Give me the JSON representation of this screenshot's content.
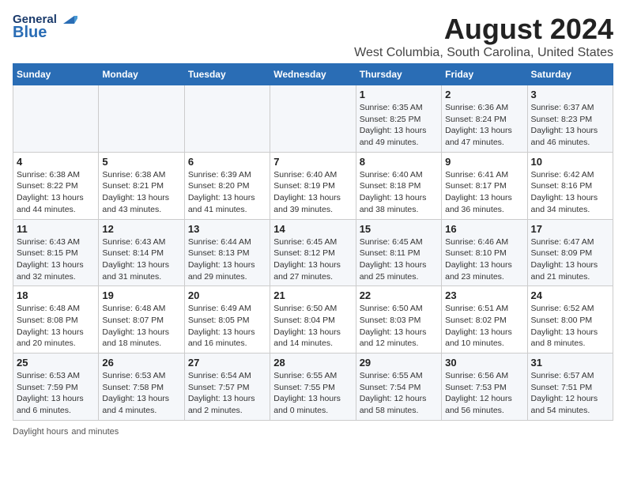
{
  "logo": {
    "general": "General",
    "blue": "Blue"
  },
  "title": "August 2024",
  "subtitle": "West Columbia, South Carolina, United States",
  "days_of_week": [
    "Sunday",
    "Monday",
    "Tuesday",
    "Wednesday",
    "Thursday",
    "Friday",
    "Saturday"
  ],
  "weeks": [
    [
      {
        "day": "",
        "info": ""
      },
      {
        "day": "",
        "info": ""
      },
      {
        "day": "",
        "info": ""
      },
      {
        "day": "",
        "info": ""
      },
      {
        "day": "1",
        "info": "Sunrise: 6:35 AM\nSunset: 8:25 PM\nDaylight: 13 hours\nand 49 minutes."
      },
      {
        "day": "2",
        "info": "Sunrise: 6:36 AM\nSunset: 8:24 PM\nDaylight: 13 hours\nand 47 minutes."
      },
      {
        "day": "3",
        "info": "Sunrise: 6:37 AM\nSunset: 8:23 PM\nDaylight: 13 hours\nand 46 minutes."
      }
    ],
    [
      {
        "day": "4",
        "info": "Sunrise: 6:38 AM\nSunset: 8:22 PM\nDaylight: 13 hours\nand 44 minutes."
      },
      {
        "day": "5",
        "info": "Sunrise: 6:38 AM\nSunset: 8:21 PM\nDaylight: 13 hours\nand 43 minutes."
      },
      {
        "day": "6",
        "info": "Sunrise: 6:39 AM\nSunset: 8:20 PM\nDaylight: 13 hours\nand 41 minutes."
      },
      {
        "day": "7",
        "info": "Sunrise: 6:40 AM\nSunset: 8:19 PM\nDaylight: 13 hours\nand 39 minutes."
      },
      {
        "day": "8",
        "info": "Sunrise: 6:40 AM\nSunset: 8:18 PM\nDaylight: 13 hours\nand 38 minutes."
      },
      {
        "day": "9",
        "info": "Sunrise: 6:41 AM\nSunset: 8:17 PM\nDaylight: 13 hours\nand 36 minutes."
      },
      {
        "day": "10",
        "info": "Sunrise: 6:42 AM\nSunset: 8:16 PM\nDaylight: 13 hours\nand 34 minutes."
      }
    ],
    [
      {
        "day": "11",
        "info": "Sunrise: 6:43 AM\nSunset: 8:15 PM\nDaylight: 13 hours\nand 32 minutes."
      },
      {
        "day": "12",
        "info": "Sunrise: 6:43 AM\nSunset: 8:14 PM\nDaylight: 13 hours\nand 31 minutes."
      },
      {
        "day": "13",
        "info": "Sunrise: 6:44 AM\nSunset: 8:13 PM\nDaylight: 13 hours\nand 29 minutes."
      },
      {
        "day": "14",
        "info": "Sunrise: 6:45 AM\nSunset: 8:12 PM\nDaylight: 13 hours\nand 27 minutes."
      },
      {
        "day": "15",
        "info": "Sunrise: 6:45 AM\nSunset: 8:11 PM\nDaylight: 13 hours\nand 25 minutes."
      },
      {
        "day": "16",
        "info": "Sunrise: 6:46 AM\nSunset: 8:10 PM\nDaylight: 13 hours\nand 23 minutes."
      },
      {
        "day": "17",
        "info": "Sunrise: 6:47 AM\nSunset: 8:09 PM\nDaylight: 13 hours\nand 21 minutes."
      }
    ],
    [
      {
        "day": "18",
        "info": "Sunrise: 6:48 AM\nSunset: 8:08 PM\nDaylight: 13 hours\nand 20 minutes."
      },
      {
        "day": "19",
        "info": "Sunrise: 6:48 AM\nSunset: 8:07 PM\nDaylight: 13 hours\nand 18 minutes."
      },
      {
        "day": "20",
        "info": "Sunrise: 6:49 AM\nSunset: 8:05 PM\nDaylight: 13 hours\nand 16 minutes."
      },
      {
        "day": "21",
        "info": "Sunrise: 6:50 AM\nSunset: 8:04 PM\nDaylight: 13 hours\nand 14 minutes."
      },
      {
        "day": "22",
        "info": "Sunrise: 6:50 AM\nSunset: 8:03 PM\nDaylight: 13 hours\nand 12 minutes."
      },
      {
        "day": "23",
        "info": "Sunrise: 6:51 AM\nSunset: 8:02 PM\nDaylight: 13 hours\nand 10 minutes."
      },
      {
        "day": "24",
        "info": "Sunrise: 6:52 AM\nSunset: 8:00 PM\nDaylight: 13 hours\nand 8 minutes."
      }
    ],
    [
      {
        "day": "25",
        "info": "Sunrise: 6:53 AM\nSunset: 7:59 PM\nDaylight: 13 hours\nand 6 minutes."
      },
      {
        "day": "26",
        "info": "Sunrise: 6:53 AM\nSunset: 7:58 PM\nDaylight: 13 hours\nand 4 minutes."
      },
      {
        "day": "27",
        "info": "Sunrise: 6:54 AM\nSunset: 7:57 PM\nDaylight: 13 hours\nand 2 minutes."
      },
      {
        "day": "28",
        "info": "Sunrise: 6:55 AM\nSunset: 7:55 PM\nDaylight: 13 hours\nand 0 minutes."
      },
      {
        "day": "29",
        "info": "Sunrise: 6:55 AM\nSunset: 7:54 PM\nDaylight: 12 hours\nand 58 minutes."
      },
      {
        "day": "30",
        "info": "Sunrise: 6:56 AM\nSunset: 7:53 PM\nDaylight: 12 hours\nand 56 minutes."
      },
      {
        "day": "31",
        "info": "Sunrise: 6:57 AM\nSunset: 7:51 PM\nDaylight: 12 hours\nand 54 minutes."
      }
    ]
  ],
  "footer": {
    "daylight_hours": "Daylight hours",
    "and_minutes": "and minutes"
  }
}
